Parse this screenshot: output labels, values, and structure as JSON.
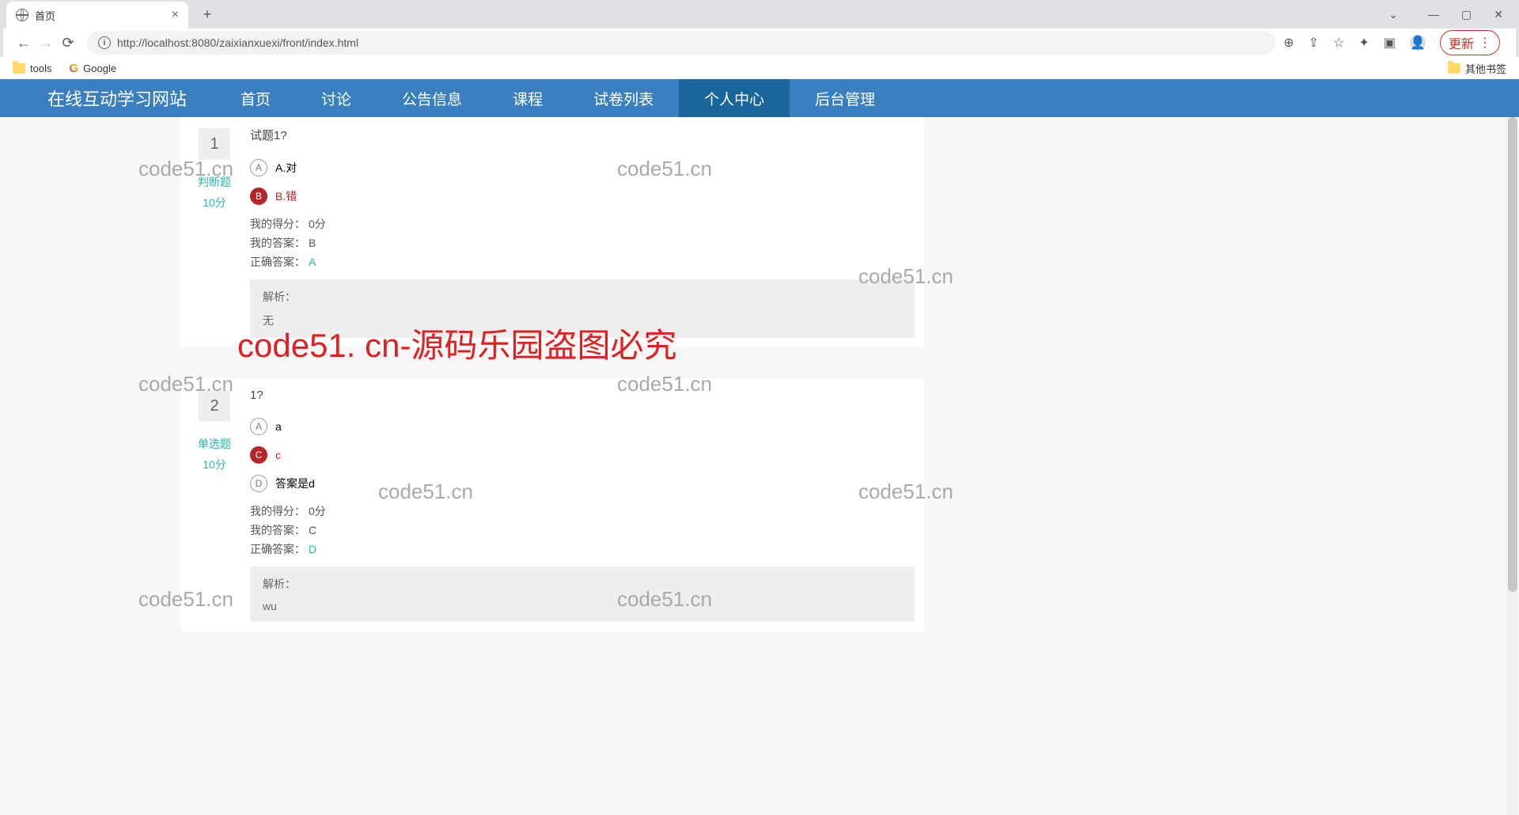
{
  "browser": {
    "tab_title": "首页",
    "url": "http://localhost:8080/zaixianxuexi/front/index.html",
    "update_label": "更新",
    "bookmarks": {
      "tools": "tools",
      "google": "Google",
      "other": "其他书签"
    }
  },
  "nav": {
    "brand": "在线互动学习网站",
    "items": [
      "首页",
      "讨论",
      "公告信息",
      "课程",
      "试卷列表",
      "个人中心",
      "后台管理"
    ],
    "active_index": 5
  },
  "labels": {
    "my_score": "我的得分：",
    "my_answer": "我的答案：",
    "correct_answer": "正确答案：",
    "analysis": "解析："
  },
  "questions": [
    {
      "num": "1",
      "type": "判断题",
      "score": "10分",
      "title": "试题1?",
      "options": [
        {
          "letter": "A",
          "text": "A.对",
          "selected": false
        },
        {
          "letter": "B",
          "text": "B.错",
          "selected": true
        }
      ],
      "my_score": "0分",
      "my_answer": "B",
      "correct_answer": "A",
      "analysis": "无"
    },
    {
      "num": "2",
      "type": "单选题",
      "score": "10分",
      "title": "1?",
      "options": [
        {
          "letter": "A",
          "text": "a",
          "selected": false
        },
        {
          "letter": "C",
          "text": "c",
          "selected": true
        },
        {
          "letter": "D",
          "text": "答案是d",
          "selected": false
        }
      ],
      "my_score": "0分",
      "my_answer": "C",
      "correct_answer": "D",
      "analysis": "wu"
    }
  ],
  "watermarks": {
    "gray": "code51.cn",
    "red": "code51. cn-源码乐园盗图必究"
  }
}
